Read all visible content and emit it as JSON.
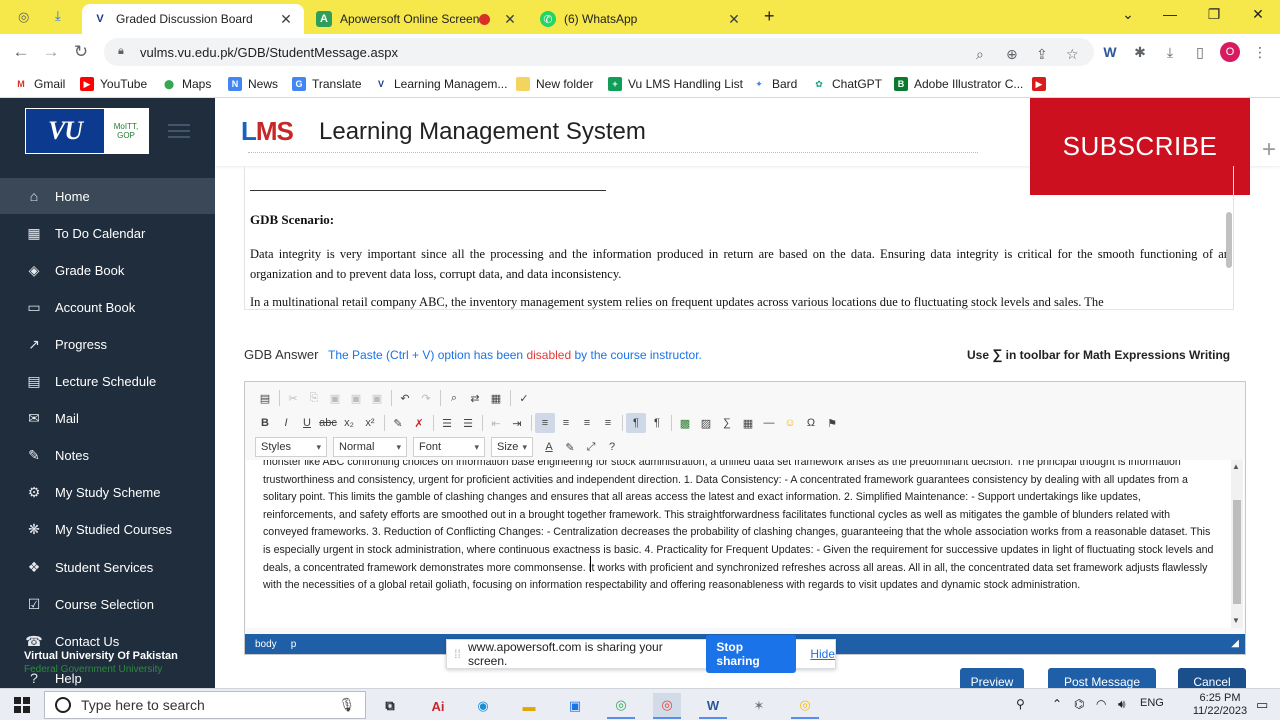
{
  "browser": {
    "tabs": [
      {
        "title": "Graded Discussion Board",
        "icon": "vu-icon",
        "active": true
      },
      {
        "title": "Apowersoft Online Screen R",
        "icon": "apowersoft-icon",
        "active": false
      },
      {
        "title": "(6) WhatsApp",
        "icon": "whatsapp-icon",
        "active": false
      }
    ],
    "url": "vulms.vu.edu.pk/GDB/StudentMessage.aspx",
    "profile_initial": "O",
    "bookmarks": [
      "Gmail",
      "YouTube",
      "Maps",
      "News",
      "Translate",
      "Learning Managem...",
      "New folder",
      "Vu LMS Handling List",
      "Bard",
      "ChatGPT",
      "Adobe Illustrator C..."
    ]
  },
  "sidebar": {
    "logo_text": "VU",
    "gov_text": "MoITT, GOP",
    "items": [
      {
        "label": "Home",
        "icon": "home-icon",
        "glyph": "⌂",
        "active": true
      },
      {
        "label": "To Do Calendar",
        "icon": "calendar-icon",
        "glyph": "▦"
      },
      {
        "label": "Grade Book",
        "icon": "layers-icon",
        "glyph": "◈"
      },
      {
        "label": "Account Book",
        "icon": "money-icon",
        "glyph": "▭"
      },
      {
        "label": "Progress",
        "icon": "chart-icon",
        "glyph": "↗"
      },
      {
        "label": "Lecture Schedule",
        "icon": "schedule-icon",
        "glyph": "▤"
      },
      {
        "label": "Mail",
        "icon": "mail-icon",
        "glyph": "✉"
      },
      {
        "label": "Notes",
        "icon": "notes-icon",
        "glyph": "✎"
      },
      {
        "label": "My Study Scheme",
        "icon": "gear-icon",
        "glyph": "⚙"
      },
      {
        "label": "My Studied Courses",
        "icon": "courses-icon",
        "glyph": "❋"
      },
      {
        "label": "Student Services",
        "icon": "services-icon",
        "glyph": "❖"
      },
      {
        "label": "Course Selection",
        "icon": "checklist-icon",
        "glyph": "☑"
      },
      {
        "label": "Contact Us",
        "icon": "contact-icon",
        "glyph": "☎"
      },
      {
        "label": "Help",
        "icon": "help-icon",
        "glyph": "?"
      }
    ],
    "footer_brand": "Virtual University Of Pakistan",
    "footer_sub": "Federal Government University"
  },
  "header": {
    "logo_l": "L",
    "logo_ms": "MS",
    "title": "Learning Management System",
    "subscribe": "SUBSCRIBE"
  },
  "scenario": {
    "heading": "GDB Scenario:",
    "p1": "Data integrity is very important since all the processing and the information produced in return are based on the data. Ensuring data integrity is critical for the smooth functioning of an organization and to prevent data loss, corrupt data, and data inconsistency.",
    "p2": "In a multinational retail company ABC, the inventory management system relies on frequent updates across various locations due to fluctuating stock levels and sales. The"
  },
  "gdb": {
    "label": "GDB Answer",
    "note_pre": "The Paste (Ctrl + V) option has been ",
    "note_red": "disabled",
    "note_post": " by the course instructor.",
    "math_hint_pre": "Use ",
    "math_hint_sym": "∑",
    "math_hint_post": " in toolbar for Math Expressions Writing"
  },
  "editor": {
    "styles": "Styles",
    "format": "Normal",
    "font": "Font",
    "size": "Size",
    "body_text": "monster like ABC confronting choices on information base engineering for stock administration, a unified data set framework arises as the predominant decision. The principal thought is information trustworthiness and consistency, urgent for proficient activities and independent direction. 1. Data Consistency: - A concentrated framework guarantees consistency by dealing with all updates from a solitary point. This limits the gamble of clashing changes and ensures that all areas access the latest and exact information. 2. Simplified Maintenance: - Support undertakings like updates, reinforcements, and safety efforts are smoothed out in a brought together framework. This straightforwardness facilitates functional cycles as well as mitigates the gamble of blunders related with conveyed frameworks. 3. Reduction of Conflicting Changes: - Centralization decreases the probability of clashing changes, guaranteeing that the whole association works from a reasonable dataset. This is especially urgent in stock administration, where continuous exactness is basic. 4. Practicality for Frequent Updates: - Given the requirement for successive updates in light of fluctuating stock levels and deals, a concentrated framework demonstrates more commonsense. It works with proficient and synchronized refreshes across all areas. All in all, the concentrated data set framework adjusts flawlessly with the necessities of a global retail goliath, focusing on information respectability and offering reasonableness with regards to visit updates and dynamic stock administration.",
    "path_body": "body",
    "path_p": "p"
  },
  "sharebar": {
    "message": "www.apowersoft.com is sharing your screen.",
    "stop": "Stop sharing",
    "hide": "Hide"
  },
  "actions": {
    "preview": "Preview",
    "post": "Post Message",
    "cancel": "Cancel"
  },
  "taskbar": {
    "search_placeholder": "Type here to search",
    "lang": "ENG",
    "time": "6:25 PM",
    "date": "11/22/2023"
  }
}
